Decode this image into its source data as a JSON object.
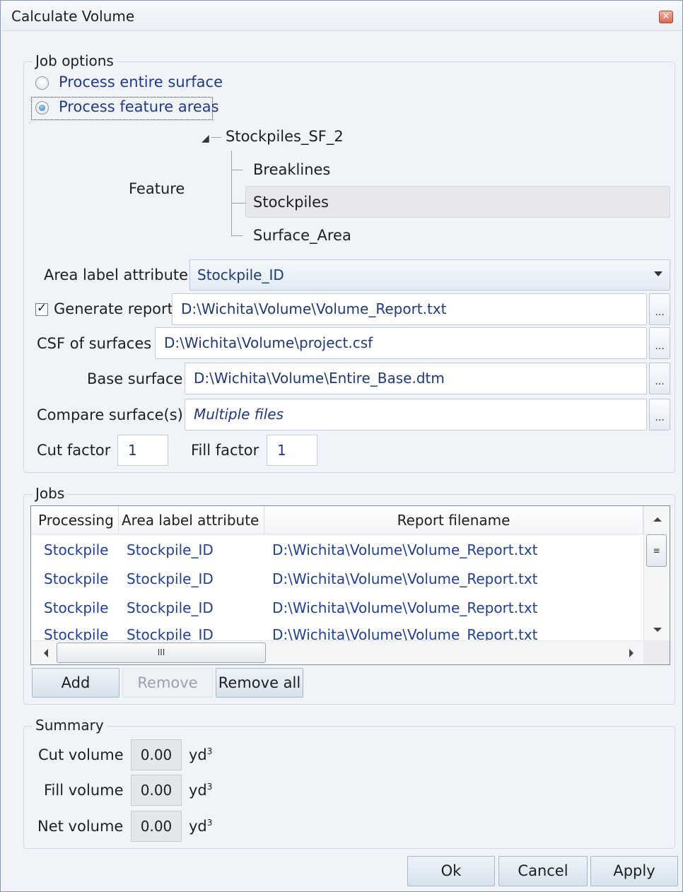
{
  "window": {
    "title": "Calculate Volume"
  },
  "job_options": {
    "group_label": "Job options",
    "radio_entire": "Process entire surface",
    "radio_feature": "Process feature areas",
    "selected": "Process feature areas",
    "feature_label": "Feature",
    "tree": {
      "root": "Stockpiles_SF_2",
      "children": [
        "Breaklines",
        "Stockpiles",
        "Surface_Area"
      ],
      "selected": "Stockpiles"
    },
    "area_label_attribute": {
      "label": "Area label attribute",
      "value": "Stockpile_ID"
    },
    "generate_report": {
      "label": "Generate report",
      "checked": true,
      "value": "D:\\Wichita\\Volume\\Volume_Report.txt"
    },
    "csf_of_surfaces": {
      "label": "CSF of surfaces",
      "value": "D:\\Wichita\\Volume\\project.csf"
    },
    "base_surface": {
      "label": "Base surface",
      "value": "D:\\Wichita\\Volume\\Entire_Base.dtm"
    },
    "compare_surfaces": {
      "label": "Compare surface(s)",
      "value": "Multiple files"
    },
    "cut_factor": {
      "label": "Cut factor",
      "value": "1"
    },
    "fill_factor": {
      "label": "Fill factor",
      "value": "1"
    },
    "browse_label": "..."
  },
  "jobs": {
    "group_label": "Jobs",
    "columns": [
      "Processing",
      "Area label attribute",
      "Report filename"
    ],
    "rows": [
      [
        "Stockpile",
        "Stockpile_ID",
        "D:\\Wichita\\Volume\\Volume_Report.txt"
      ],
      [
        "Stockpile",
        "Stockpile_ID",
        "D:\\Wichita\\Volume\\Volume_Report.txt"
      ],
      [
        "Stockpile",
        "Stockpile_ID",
        "D:\\Wichita\\Volume\\Volume_Report.txt"
      ],
      [
        "Stockpile",
        "Stockpile_ID",
        "D:\\Wichita\\Volume\\Volume_Report.txt"
      ]
    ],
    "scroll_thumb_glyph": "III",
    "add_button": "Add",
    "remove_button": "Remove",
    "remove_all_button": "Remove all"
  },
  "summary": {
    "group_label": "Summary",
    "cut_volume": {
      "label": "Cut volume",
      "value": "0.00",
      "unit": "yd",
      "unit_sup": "3"
    },
    "fill_volume": {
      "label": "Fill volume",
      "value": "0.00",
      "unit": "yd",
      "unit_sup": "3"
    },
    "net_volume": {
      "label": "Net volume",
      "value": "0.00",
      "unit": "yd",
      "unit_sup": "3"
    }
  },
  "footer": {
    "ok": "Ok",
    "cancel": "Cancel",
    "apply": "Apply"
  },
  "colors": {
    "window_bg": "#f0f4f9",
    "value_text": "#1e3a7a",
    "link_blue": "#1e3f9a"
  },
  "icons": [
    "close-icon",
    "tree-collapse-icon",
    "dropdown-arrow-icon",
    "checkmark-icon",
    "scroll-up-icon",
    "scroll-down-icon",
    "scroll-left-icon",
    "scroll-right-icon"
  ]
}
